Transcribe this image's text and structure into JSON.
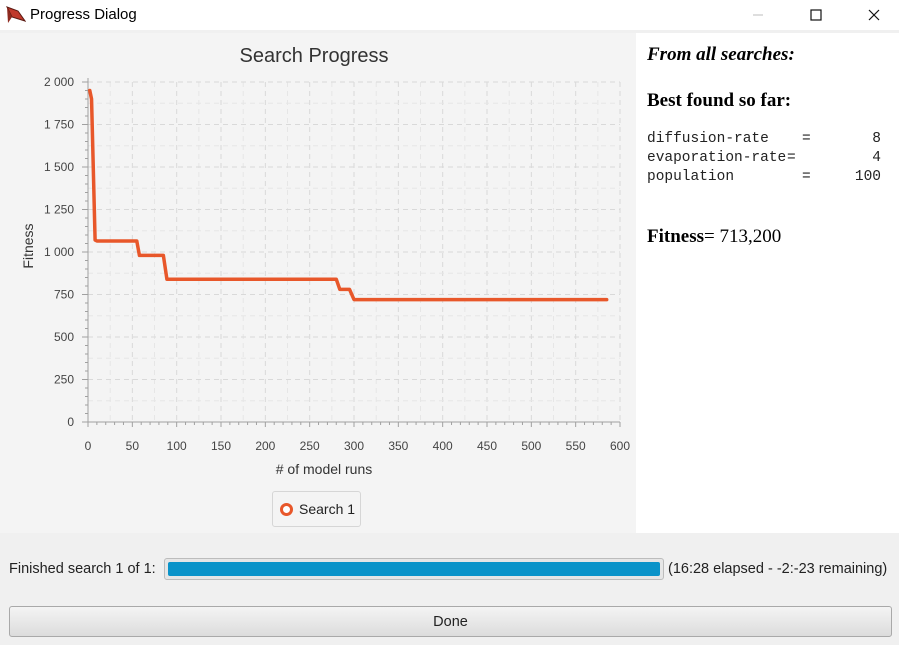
{
  "window": {
    "title": "Progress Dialog",
    "icon": "app-logo-icon",
    "controls": [
      "minimize-icon",
      "maximize-icon",
      "close-icon"
    ]
  },
  "chart_data": {
    "type": "line",
    "title": "Search Progress",
    "xlabel": "# of model runs",
    "ylabel": "Fitness",
    "xlim": [
      0,
      600
    ],
    "ylim": [
      0,
      2000
    ],
    "x_ticks": [
      "0",
      "50",
      "100",
      "150",
      "200",
      "250",
      "300",
      "350",
      "400",
      "450",
      "500",
      "550",
      "600"
    ],
    "y_ticks": [
      "0",
      "250",
      "500",
      "750",
      "1 000",
      "1 250",
      "1 500",
      "1 750",
      "2 000"
    ],
    "grid": true,
    "legend_position": "bottom-center",
    "series": [
      {
        "name": "Search 1",
        "color": "#e8572a",
        "x": [
          2,
          4,
          8,
          10,
          55,
          58,
          85,
          89,
          280,
          284,
          295,
          300,
          585
        ],
        "y": [
          1950,
          1900,
          1070,
          1065,
          1065,
          980,
          980,
          840,
          840,
          780,
          780,
          720,
          720
        ]
      }
    ]
  },
  "legend": {
    "label": "Search 1"
  },
  "info": {
    "heading": "From all searches:",
    "subheading": "Best found so far:",
    "params": [
      {
        "name": "diffusion-rate",
        "eq": "=",
        "value": "8"
      },
      {
        "name": "evaporation-rate",
        "eq": "=",
        "value": "4"
      },
      {
        "name": "population",
        "eq": "=",
        "value": "100"
      }
    ],
    "fitness_label": "Fitness",
    "fitness_value": "= 713,200"
  },
  "status": {
    "label": "Finished search 1 of 1:",
    "progress": 1.0,
    "time_text": "(16:28 elapsed - -2:-23 remaining)"
  },
  "done_button": {
    "label": "Done"
  }
}
